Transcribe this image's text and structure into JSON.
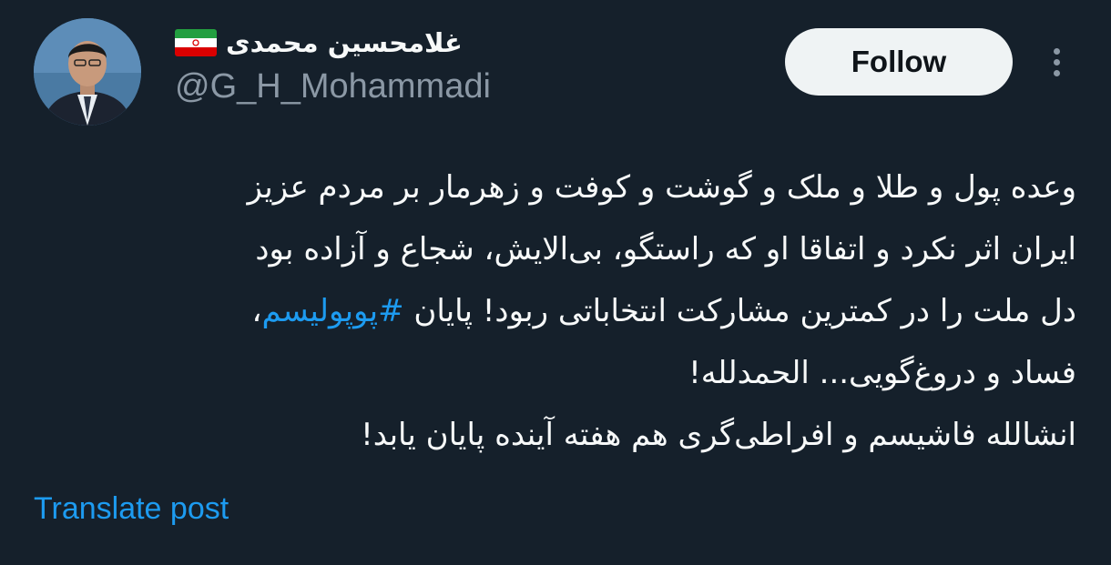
{
  "author": {
    "display_name": "غلامحسین محمدی",
    "handle": "@G_H_Mohammadi",
    "flag_icon": "iran-flag-icon"
  },
  "actions": {
    "follow_label": "Follow",
    "more_icon": "more-vertical-icon"
  },
  "post": {
    "line1": "وعده پول و طلا و ملک و گوشت و کوفت و زهرمار بر مردم عزیز",
    "line2": "ایران اثر نکرد و اتفاقا او که راستگو، بی‌الایش، شجاع و آزاده بود",
    "line3_text": "دل ملت را در کمترین مشارکت انتخاباتی ربود! پایان ",
    "line3_hashtag": "#پوپولیسم",
    "line3_end": "،",
    "line4": "فساد و دروغ‌گویی... الحمدلله!",
    "line5": "انشالله فاشیسم و افراطی‌گری هم هفته آینده پایان یابد!"
  },
  "translate_label": "Translate post",
  "colors": {
    "background": "#15202b",
    "accent": "#1d9bf0",
    "secondary_text": "#8b98a5"
  }
}
